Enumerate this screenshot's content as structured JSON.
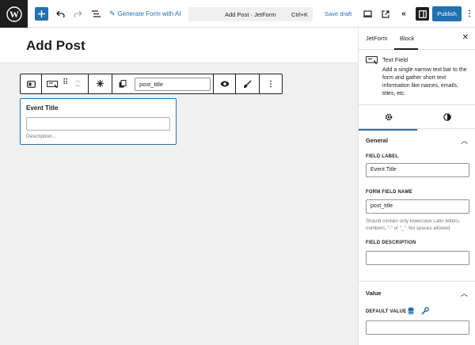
{
  "topbar": {
    "generate_ai_label": "Generate Form with AI",
    "doc_title": "Add Post · JetForm",
    "shortcut": "Ctrl+K",
    "save_draft_label": "Save draft",
    "publish_label": "Publish"
  },
  "canvas": {
    "post_title": "Add Post",
    "toolbar": {
      "field_name_value": "post_title"
    },
    "block": {
      "label": "Event Title",
      "description": "Description..."
    }
  },
  "sidebar": {
    "tabs": [
      "JetForm",
      "Block"
    ],
    "active_tab": "Block",
    "block_card": {
      "title": "Text Field",
      "description": "Add a single narrow text bar to the form and gather short text information like names, emails, titles, etc."
    },
    "general": {
      "title": "General",
      "field_label_label": "FIELD LABEL",
      "field_label_value": "Event Title",
      "form_field_name_label": "FORM FIELD NAME",
      "form_field_name_value": "post_title",
      "form_field_name_help": "Should contain only lowercase Latin letters, numbers, \"-\" or \"_\". No spaces allowed.",
      "field_description_label": "FIELD DESCRIPTION",
      "field_description_value": ""
    },
    "value": {
      "title": "Value",
      "default_value_label": "DEFAULT VALUE",
      "default_value_value": ""
    }
  },
  "colors": {
    "accent": "#2271b1",
    "dark": "#1e1e1e",
    "canvas_bg": "#f0f0f0"
  }
}
